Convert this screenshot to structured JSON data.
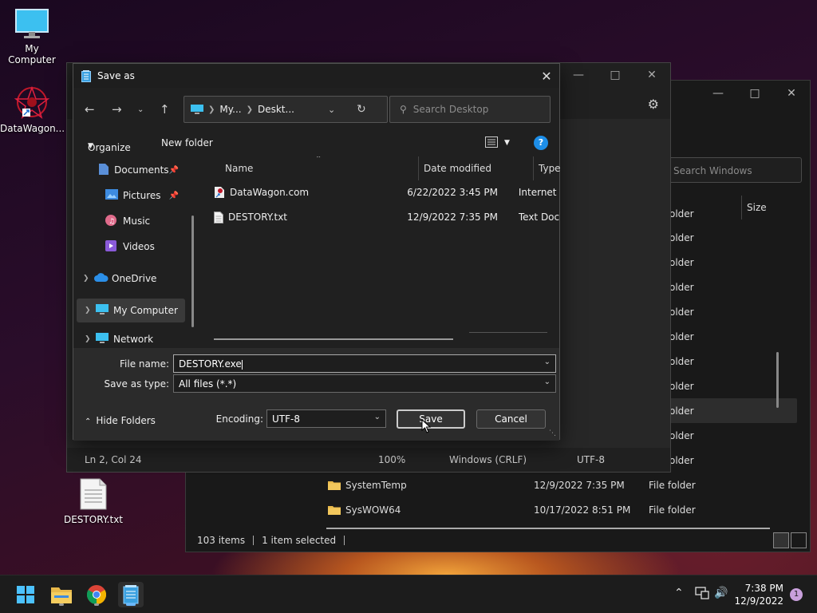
{
  "desktop": {
    "icons": [
      {
        "label": "My Computer"
      },
      {
        "label": "DataWagon..."
      },
      {
        "label": "DESTORY.txt"
      }
    ]
  },
  "explorer": {
    "search_placeholder": "Search Windows",
    "col_size": "Size",
    "partial_rows": [
      "older",
      "older",
      "older",
      "older",
      "older",
      "older",
      "older",
      "older",
      "older",
      "older",
      "older"
    ],
    "rows": [
      {
        "name": "SystemTemp",
        "date": "12/9/2022 7:35 PM",
        "type": "File folder"
      },
      {
        "name": "SysWOW64",
        "date": "10/17/2022 8:51 PM",
        "type": "File folder"
      }
    ],
    "status": {
      "items": "103 items",
      "selected": "1 item selected"
    }
  },
  "notepad": {
    "status": {
      "position": "Ln 2, Col 24",
      "zoom": "100%",
      "line_ending": "Windows (CRLF)",
      "encoding": "UTF-8"
    }
  },
  "dialog": {
    "title": "Save as",
    "breadcrumb": [
      "My...",
      "Deskt..."
    ],
    "search_placeholder": "Search Desktop",
    "organize": "Organize",
    "new_folder": "New folder",
    "help": "?",
    "nav": [
      "Documents",
      "Pictures",
      "Music",
      "Videos",
      "OneDrive",
      "My Computer",
      "Network"
    ],
    "columns": {
      "name": "Name",
      "date": "Date modified",
      "type": "Type"
    },
    "files": [
      {
        "name": "DataWagon.com",
        "date": "6/22/2022 3:45 PM",
        "type": "Internet"
      },
      {
        "name": "DESTORY.txt",
        "date": "12/9/2022 7:35 PM",
        "type": "Text Doc"
      }
    ],
    "file_name_label": "File name:",
    "file_name_value": "DESTORY.exe",
    "save_type_label": "Save as type:",
    "save_type_value": "All files  (*.*)",
    "hide_folders": "Hide Folders",
    "encoding_label": "Encoding:",
    "encoding_value": "UTF-8",
    "save": "Save",
    "cancel": "Cancel"
  },
  "taskbar": {
    "time": "7:38 PM",
    "date": "12/9/2022",
    "notifications": "1"
  },
  "colors": {
    "accent": "#1d8ee8",
    "folder": "#e8b84a"
  }
}
